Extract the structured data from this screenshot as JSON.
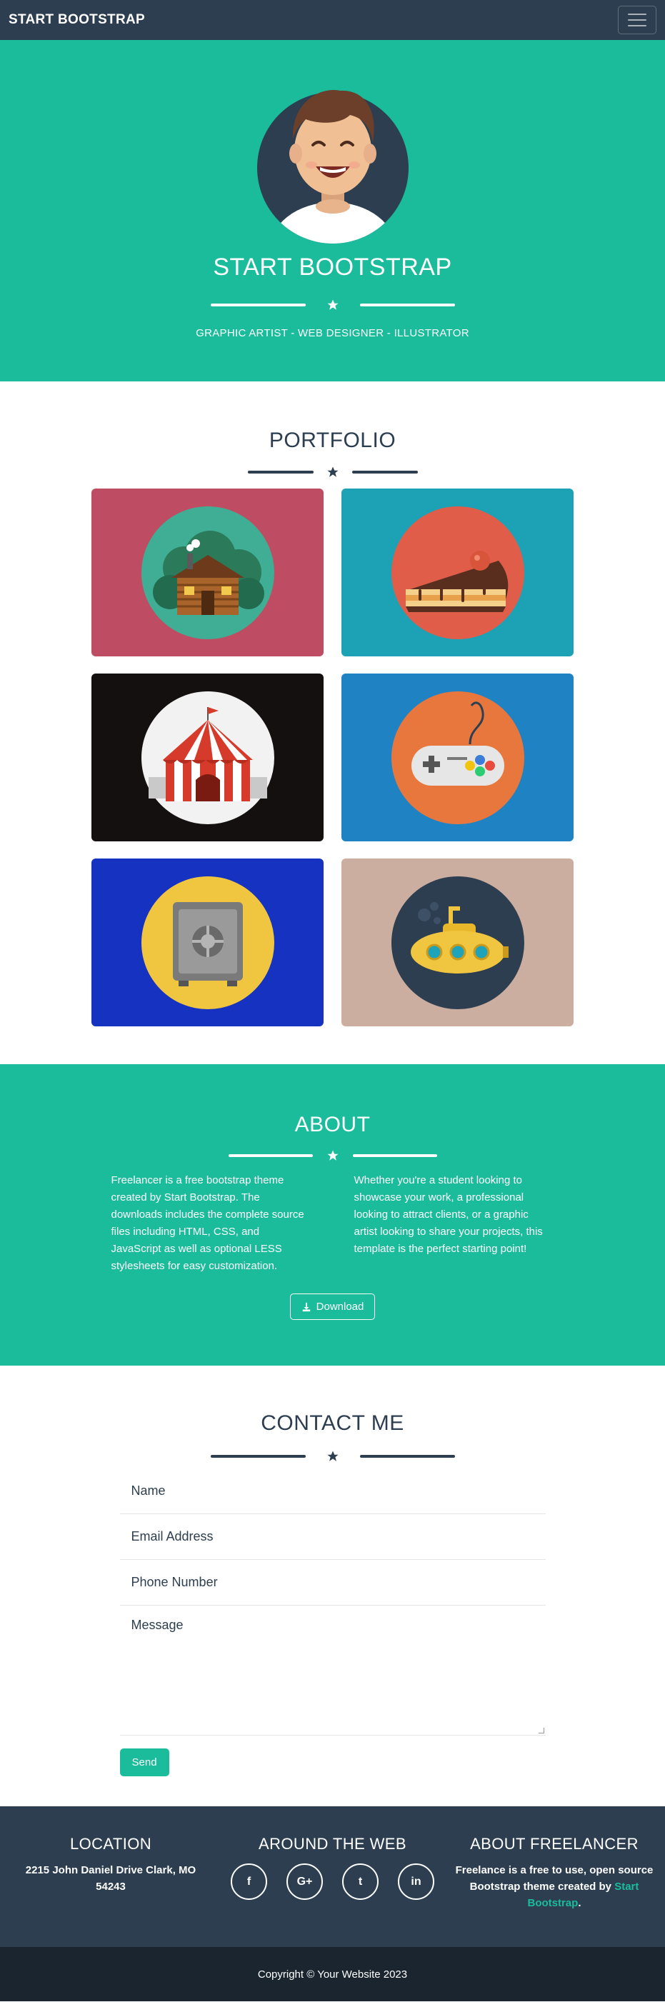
{
  "navbar": {
    "brand": "START BOOTSTRAP"
  },
  "hero": {
    "title": "START BOOTSTRAP",
    "subtitle": "GRAPHIC ARTIST - WEB DESIGNER - ILLUSTRATOR"
  },
  "portfolio": {
    "heading": "PORTFOLIO",
    "items": [
      {
        "name": "cabin",
        "bg": "#be4d63"
      },
      {
        "name": "cake",
        "bg": "#1da2b5"
      },
      {
        "name": "circus",
        "bg": "#141010"
      },
      {
        "name": "game",
        "bg": "#1f82c3"
      },
      {
        "name": "safe",
        "bg": "#1532c0"
      },
      {
        "name": "submarine",
        "bg": "#cbae9f"
      }
    ]
  },
  "about": {
    "heading": "ABOUT",
    "left": "Freelancer is a free bootstrap theme created by Start Bootstrap. The downloads includes the complete source files including HTML, CSS, and JavaScript as well as optional LESS stylesheets for easy customization.",
    "right": "Whether you're a student looking to showcase your work, a professional looking to attract clients, or a graphic artist looking to share your projects, this template is the perfect starting point!",
    "button": "Download"
  },
  "contact": {
    "heading": "CONTACT ME",
    "name_placeholder": "Name",
    "email_placeholder": "Email Address",
    "phone_placeholder": "Phone Number",
    "message_placeholder": "Message",
    "send": "Send"
  },
  "footer": {
    "location_heading": "LOCATION",
    "address": "2215 John Daniel Drive Clark, MO 54243",
    "web_heading": "AROUND THE WEB",
    "social": [
      "f",
      "G+",
      "t",
      "in"
    ],
    "about_heading": "ABOUT FREELANCER",
    "about_text": "Freelance is a free to use, open source Bootstrap theme created by",
    "about_link": "Start Bootstrap",
    "about_end": ".",
    "copyright": "Copyright © Your Website 2023"
  },
  "colors": {
    "primary": "#1abc9c",
    "dark": "#2c3e50",
    "darker": "#1a252f"
  }
}
